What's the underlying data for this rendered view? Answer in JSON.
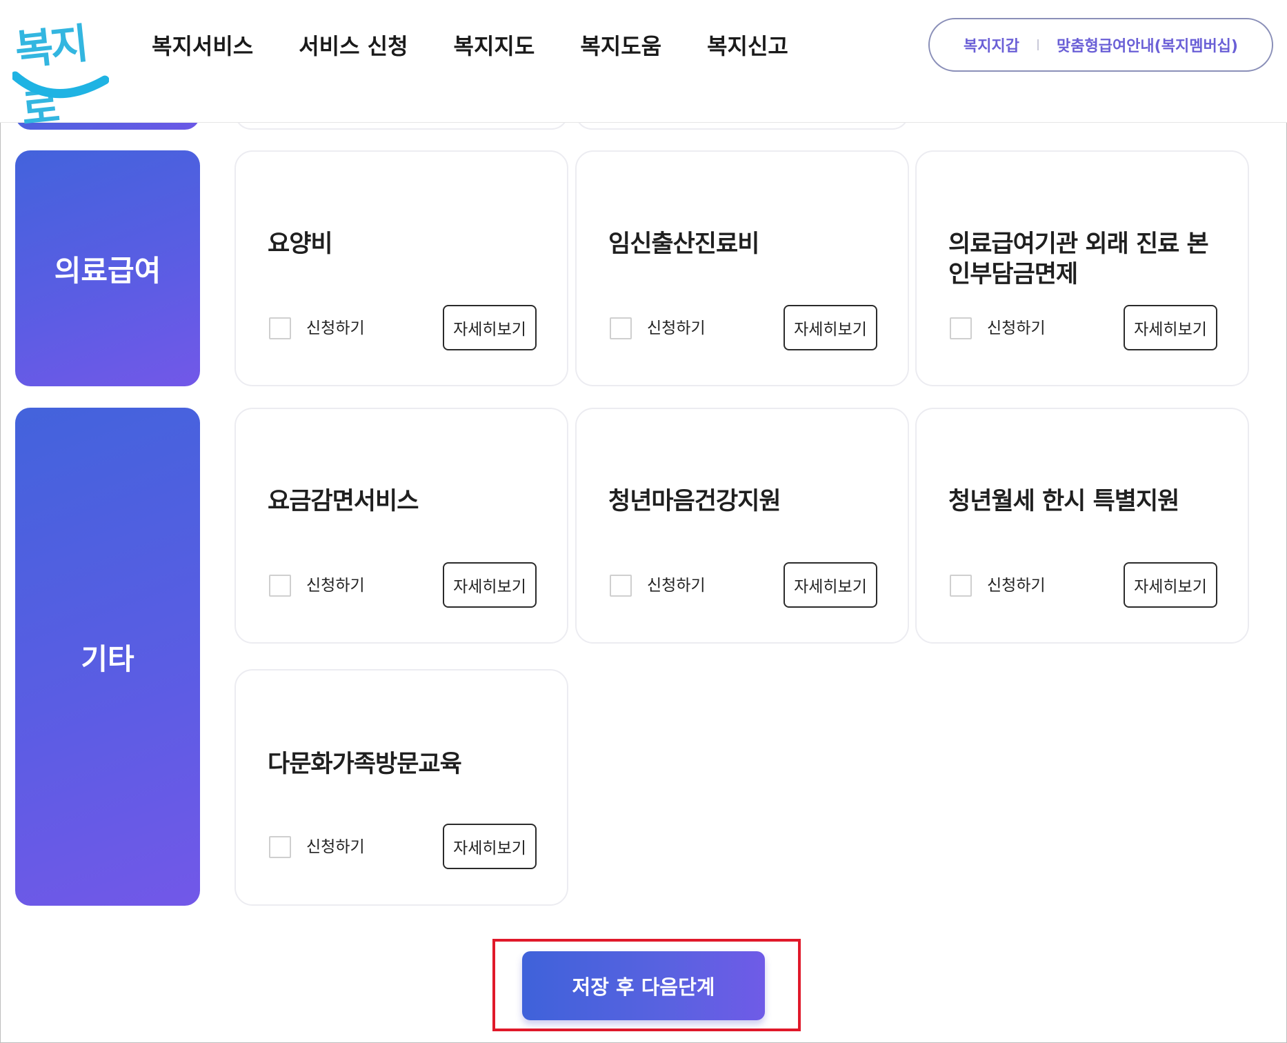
{
  "header": {
    "logo_text": "복지로",
    "nav": [
      "복지서비스",
      "서비스 신청",
      "복지지도",
      "복지도움",
      "복지신고"
    ],
    "util_links": [
      "복지지갑",
      "맞춤형급여안내(복지멤버십)"
    ]
  },
  "categories": [
    {
      "label": "의료급여",
      "services": [
        {
          "title": "요양비",
          "apply_label": "신청하기",
          "detail_label": "자세히보기",
          "checked": false
        },
        {
          "title": "임신출산진료비",
          "apply_label": "신청하기",
          "detail_label": "자세히보기",
          "checked": false
        },
        {
          "title": "의료급여기관 외래 진료 본인부담금면제",
          "apply_label": "신청하기",
          "detail_label": "자세히보기",
          "checked": false
        }
      ]
    },
    {
      "label": "기타",
      "services": [
        {
          "title": "요금감면서비스",
          "apply_label": "신청하기",
          "detail_label": "자세히보기",
          "checked": false
        },
        {
          "title": "청년마음건강지원",
          "apply_label": "신청하기",
          "detail_label": "자세히보기",
          "checked": false
        },
        {
          "title": "청년월세 한시 특별지원",
          "apply_label": "신청하기",
          "detail_label": "자세히보기",
          "checked": false
        },
        {
          "title": "다문화가족방문교육",
          "apply_label": "신청하기",
          "detail_label": "자세히보기",
          "checked": false
        }
      ]
    }
  ],
  "save_button_label": "저장 후 다음단계",
  "colors": {
    "category_gradient_start": "#4363dc",
    "category_gradient_end": "#7258e8",
    "util_link": "#6a5fd6",
    "highlight_border": "#e0192a",
    "logo": "#33b6e0"
  }
}
